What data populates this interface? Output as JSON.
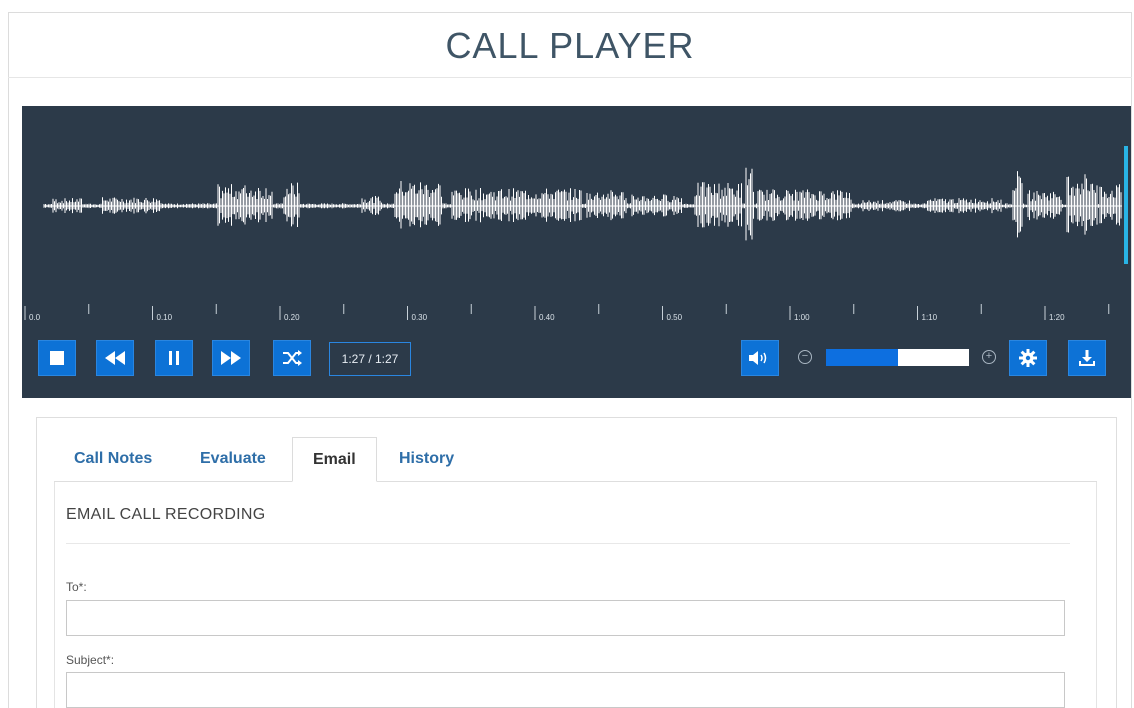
{
  "page": {
    "title": "CALL PLAYER"
  },
  "player": {
    "time_display": "1:27 / 1:27",
    "progress": 1.0,
    "zoom_level": 0.5,
    "timeline_labels": [
      "0.0",
      "0.10",
      "0.20",
      "0.30",
      "0.40",
      "0.50",
      "1:00",
      "1:10",
      "1:20"
    ],
    "buttons": {
      "stop": "stop-icon",
      "rewind": "rewind-icon",
      "pause": "pause-icon",
      "fast_forward": "fast-forward-icon",
      "shuffle": "shuffle-icon",
      "volume": "volume-icon",
      "settings": "gear-icon",
      "download": "download-icon"
    },
    "colors": {
      "background": "#2c3a49",
      "button": "#0d72d6",
      "waveform": "#ffffff",
      "playhead": "#29b4e6"
    }
  },
  "tabs": [
    {
      "label": "Call Notes",
      "active": false
    },
    {
      "label": "Evaluate",
      "active": false
    },
    {
      "label": "Email",
      "active": true
    },
    {
      "label": "History",
      "active": false
    }
  ],
  "email_form": {
    "section_title": "EMAIL CALL RECORDING",
    "to_label": "To*:",
    "to_value": "",
    "subject_label": "Subject*:",
    "subject_value": ""
  }
}
